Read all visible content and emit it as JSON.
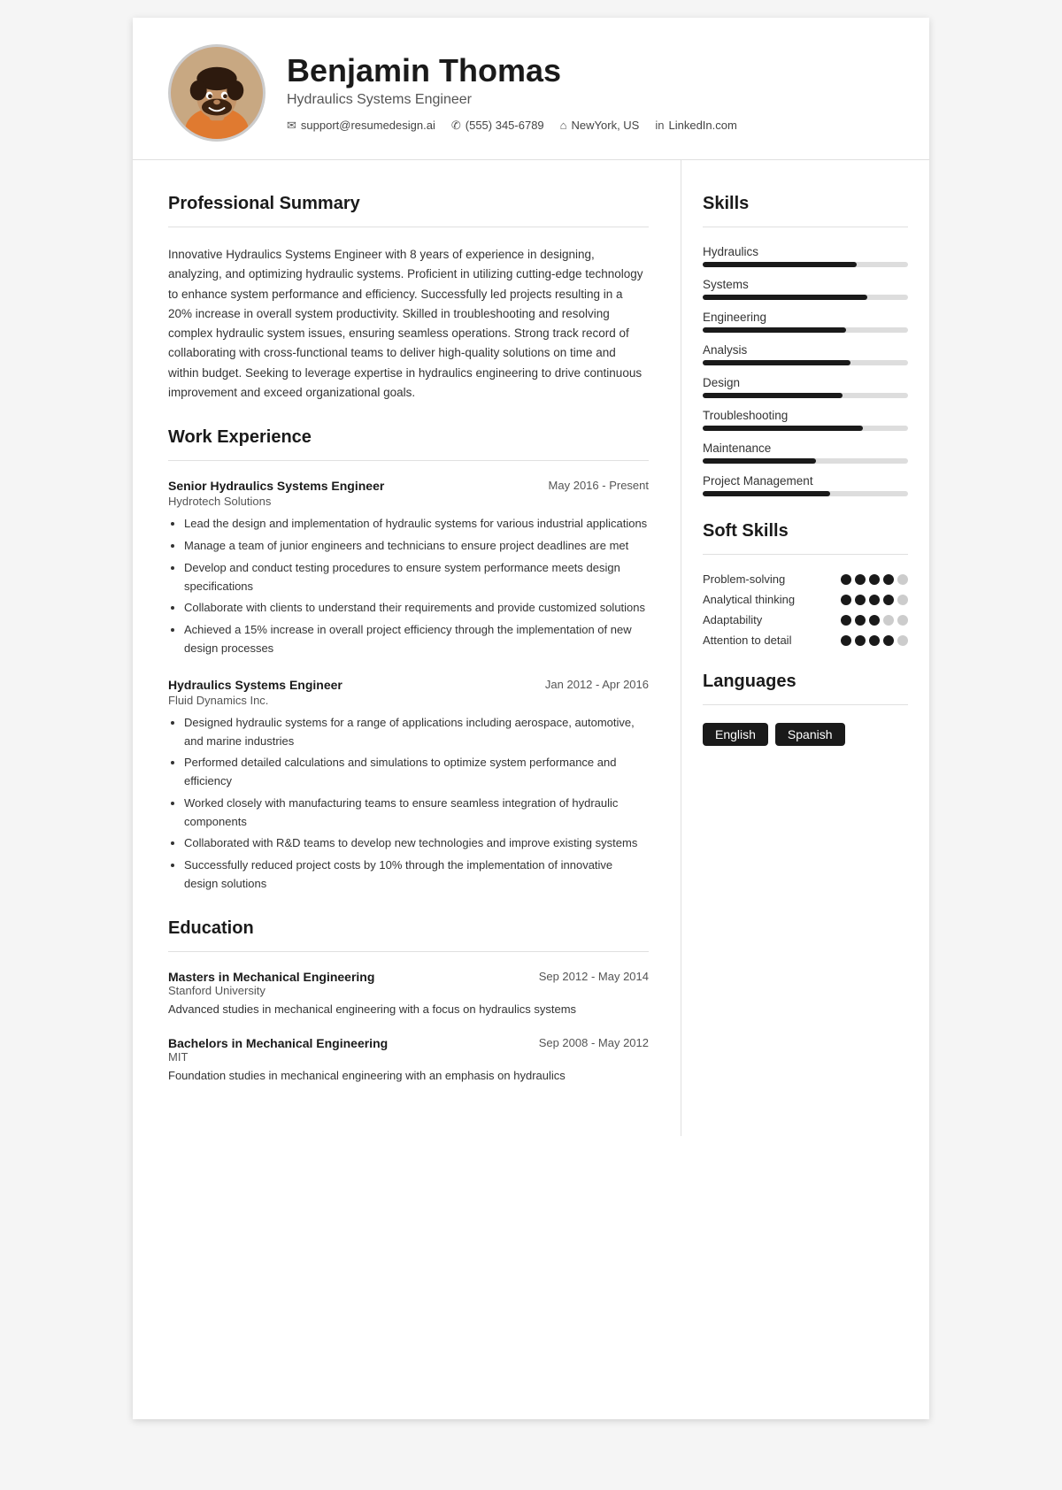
{
  "header": {
    "name": "Benjamin Thomas",
    "title": "Hydraulics Systems Engineer",
    "contacts": [
      {
        "icon": "✉",
        "text": "support@resumedesign.ai"
      },
      {
        "icon": "✆",
        "text": "(555) 345-6789"
      },
      {
        "icon": "⌂",
        "text": "NewYork, US"
      },
      {
        "icon": "in",
        "text": "LinkedIn.com"
      }
    ]
  },
  "summary": {
    "section_title": "Professional Summary",
    "text": "Innovative Hydraulics Systems Engineer with 8 years of experience in designing, analyzing, and optimizing hydraulic systems. Proficient in utilizing cutting-edge technology to enhance system performance and efficiency. Successfully led projects resulting in a 20% increase in overall system productivity. Skilled in troubleshooting and resolving complex hydraulic system issues, ensuring seamless operations. Strong track record of collaborating with cross-functional teams to deliver high-quality solutions on time and within budget. Seeking to leverage expertise in hydraulics engineering to drive continuous improvement and exceed organizational goals."
  },
  "work_experience": {
    "section_title": "Work Experience",
    "jobs": [
      {
        "title": "Senior Hydraulics Systems Engineer",
        "company": "Hydrotech Solutions",
        "dates": "May 2016 - Present",
        "bullets": [
          "Lead the design and implementation of hydraulic systems for various industrial applications",
          "Manage a team of junior engineers and technicians to ensure project deadlines are met",
          "Develop and conduct testing procedures to ensure system performance meets design specifications",
          "Collaborate with clients to understand their requirements and provide customized solutions",
          "Achieved a 15% increase in overall project efficiency through the implementation of new design processes"
        ]
      },
      {
        "title": "Hydraulics Systems Engineer",
        "company": "Fluid Dynamics Inc.",
        "dates": "Jan 2012 - Apr 2016",
        "bullets": [
          "Designed hydraulic systems for a range of applications including aerospace, automotive, and marine industries",
          "Performed detailed calculations and simulations to optimize system performance and efficiency",
          "Worked closely with manufacturing teams to ensure seamless integration of hydraulic components",
          "Collaborated with R&D teams to develop new technologies and improve existing systems",
          "Successfully reduced project costs by 10% through the implementation of innovative design solutions"
        ]
      }
    ]
  },
  "education": {
    "section_title": "Education",
    "items": [
      {
        "degree": "Masters in Mechanical Engineering",
        "school": "Stanford University",
        "dates": "Sep 2012 - May 2014",
        "desc": "Advanced studies in mechanical engineering with a focus on hydraulics systems"
      },
      {
        "degree": "Bachelors in Mechanical Engineering",
        "school": "MIT",
        "dates": "Sep 2008 - May 2012",
        "desc": "Foundation studies in mechanical engineering with an emphasis on hydraulics"
      }
    ]
  },
  "skills": {
    "section_title": "Skills",
    "items": [
      {
        "name": "Hydraulics",
        "pct": 75
      },
      {
        "name": "Systems",
        "pct": 80
      },
      {
        "name": "Engineering",
        "pct": 70
      },
      {
        "name": "Analysis",
        "pct": 72
      },
      {
        "name": "Design",
        "pct": 68
      },
      {
        "name": "Troubleshooting",
        "pct": 78
      },
      {
        "name": "Maintenance",
        "pct": 55
      },
      {
        "name": "Project Management",
        "pct": 62
      }
    ]
  },
  "soft_skills": {
    "section_title": "Soft Skills",
    "items": [
      {
        "name": "Problem-solving",
        "filled": 4,
        "total": 5
      },
      {
        "name": "Analytical thinking",
        "filled": 4,
        "total": 5
      },
      {
        "name": "Adaptability",
        "filled": 3,
        "total": 5
      },
      {
        "name": "Attention to detail",
        "filled": 4,
        "total": 5
      }
    ]
  },
  "languages": {
    "section_title": "Languages",
    "items": [
      "English",
      "Spanish"
    ]
  }
}
